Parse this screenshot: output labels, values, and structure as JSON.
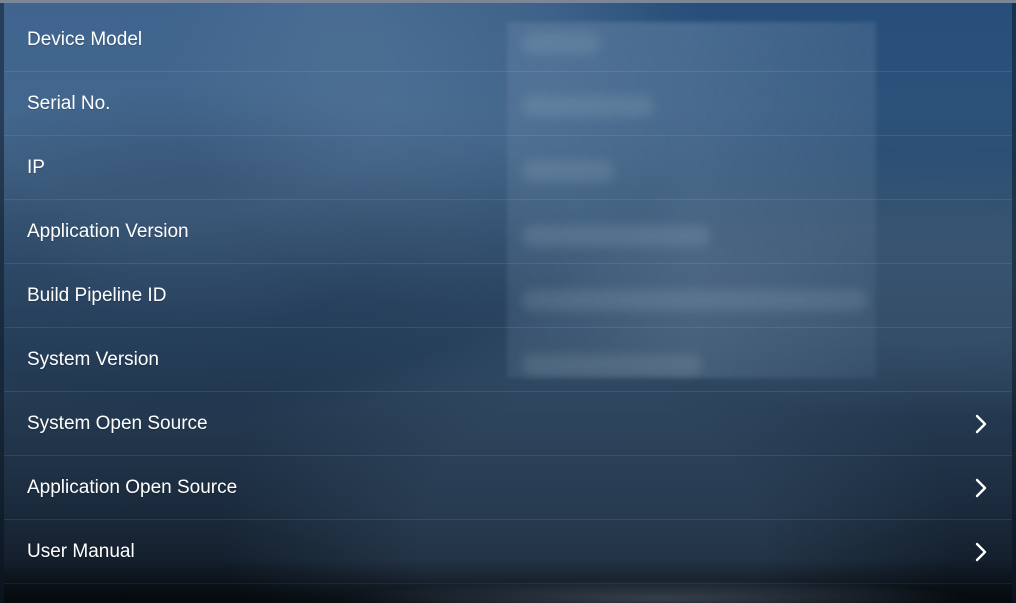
{
  "about_screen": {
    "rows": [
      {
        "label": "Device Model"
      },
      {
        "label": "Serial No."
      },
      {
        "label": "IP"
      },
      {
        "label": "Application Version"
      },
      {
        "label": "Build Pipeline ID"
      },
      {
        "label": "System Version"
      },
      {
        "label": "System Open Source",
        "icon": "chevron-right-icon"
      },
      {
        "label": "Application Open Source",
        "icon": "chevron-right-icon"
      },
      {
        "label": "User Manual",
        "icon": "chevron-right-icon"
      }
    ]
  },
  "colors": {
    "text": "#ffffff",
    "background_top": "#274e7a",
    "background_bottom": "#0e1620",
    "divider": "#dcebfa"
  }
}
